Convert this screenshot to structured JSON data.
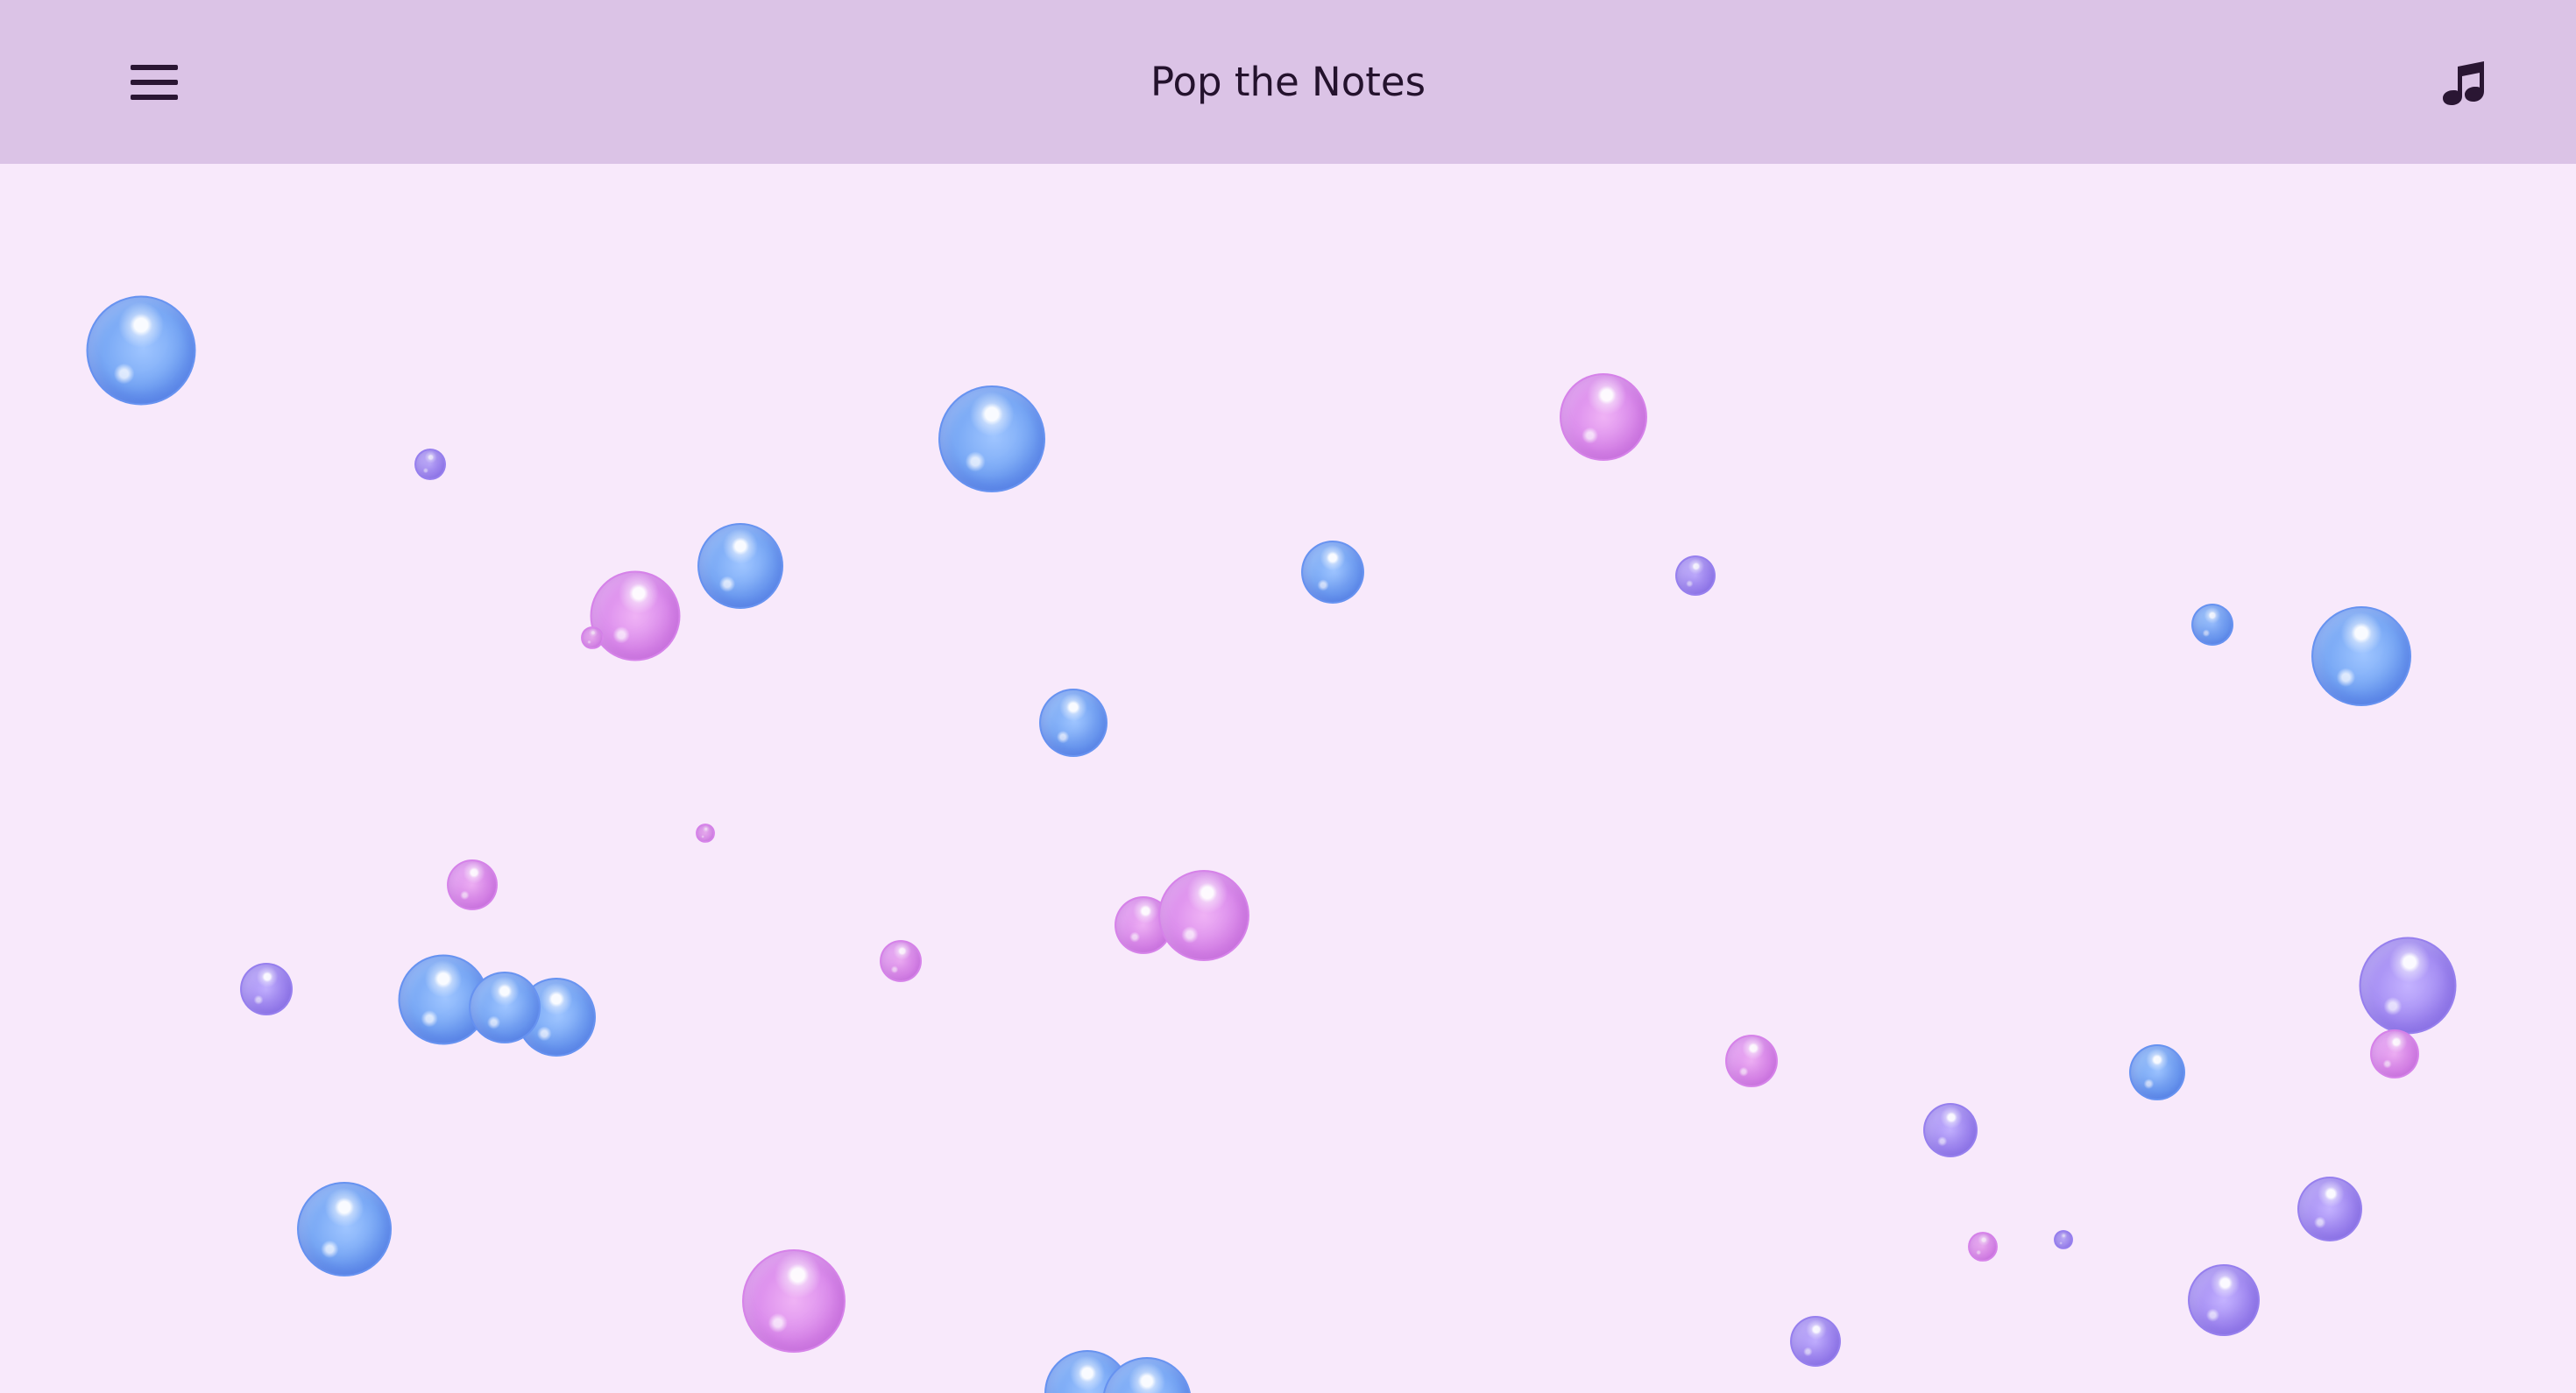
{
  "app": {
    "title": "Pop the Notes",
    "icons": {
      "menu": "menu-icon",
      "music": "music-note-icon"
    },
    "colors": {
      "header": "#dbc3e6",
      "background": "#f8e9fb",
      "title_text": "#24122d",
      "blue_bubble": "#78a8f5",
      "pink_bubble": "#dc8eed",
      "purple_bubble": "#a790f4"
    }
  },
  "bubbles": [
    {
      "color": "blue"
    },
    {
      "color": "purple"
    },
    {
      "color": "blue"
    },
    {
      "color": "pink"
    },
    {
      "color": "blue"
    },
    {
      "color": "pink"
    },
    {
      "color": "pink"
    },
    {
      "color": "blue"
    },
    {
      "color": "purple"
    },
    {
      "color": "blue"
    },
    {
      "color": "blue"
    },
    {
      "color": "blue"
    },
    {
      "color": "pink"
    },
    {
      "color": "pink"
    },
    {
      "color": "pink"
    },
    {
      "color": "blue"
    },
    {
      "color": "pink"
    },
    {
      "color": "purple"
    },
    {
      "color": "blue"
    },
    {
      "color": "blue"
    },
    {
      "color": "pink"
    },
    {
      "color": "purple"
    },
    {
      "color": "pink"
    },
    {
      "color": "pink"
    },
    {
      "color": "blue"
    },
    {
      "color": "blue"
    },
    {
      "color": "pink"
    },
    {
      "color": "purple"
    },
    {
      "color": "pink"
    },
    {
      "color": "purple"
    },
    {
      "color": "purple"
    },
    {
      "color": "purple"
    },
    {
      "color": "purple"
    },
    {
      "color": "blue"
    },
    {
      "color": "blue"
    },
    {
      "color": "pink"
    },
    {
      "color": "blue"
    },
    {
      "color": "blue"
    },
    {
      "color": "blue"
    }
  ]
}
